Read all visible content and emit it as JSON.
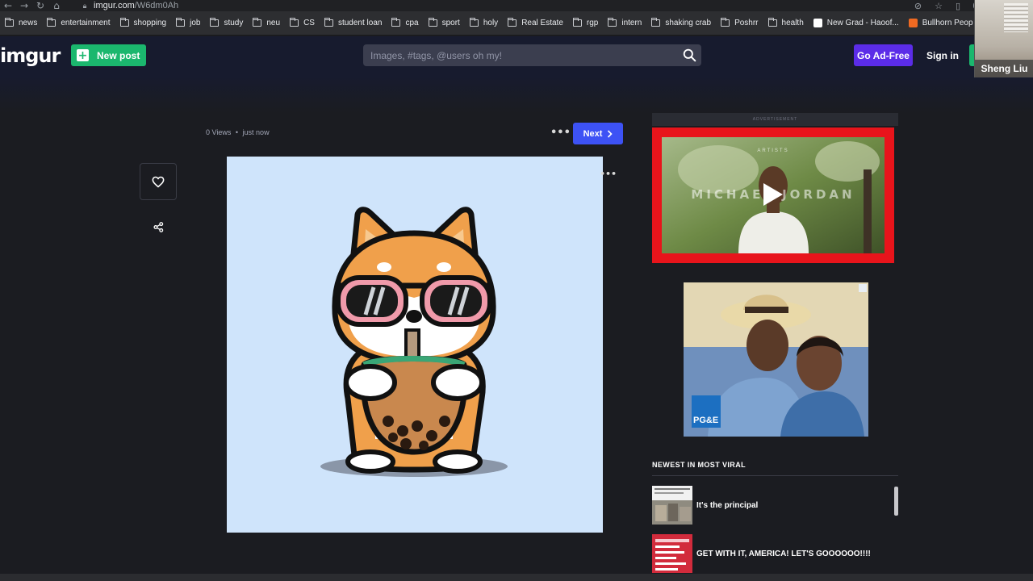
{
  "browser": {
    "url_host": "imgur.com",
    "url_path": "/W6dm0Ah",
    "bookmarks": [
      {
        "label": "news",
        "kind": "folder"
      },
      {
        "label": "entertainment",
        "kind": "folder"
      },
      {
        "label": "shopping",
        "kind": "folder"
      },
      {
        "label": "job",
        "kind": "folder"
      },
      {
        "label": "study",
        "kind": "folder"
      },
      {
        "label": "neu",
        "kind": "folder"
      },
      {
        "label": "CS",
        "kind": "folder"
      },
      {
        "label": "student loan",
        "kind": "folder"
      },
      {
        "label": "cpa",
        "kind": "folder"
      },
      {
        "label": "sport",
        "kind": "folder"
      },
      {
        "label": "holy",
        "kind": "folder"
      },
      {
        "label": "Real Estate",
        "kind": "folder"
      },
      {
        "label": "rgp",
        "kind": "folder"
      },
      {
        "label": "intern",
        "kind": "folder"
      },
      {
        "label": "shaking crab",
        "kind": "folder"
      },
      {
        "label": "Poshrr",
        "kind": "folder"
      },
      {
        "label": "health",
        "kind": "folder"
      },
      {
        "label": "New Grad - Haoof...",
        "kind": "page",
        "color": "#ffffff"
      },
      {
        "label": "Bullhorn Peop",
        "kind": "page",
        "color": "#f06a22"
      }
    ]
  },
  "webcam": {
    "name": "Sheng Liu"
  },
  "header": {
    "logo": "imgur",
    "new_post": "New post",
    "search_placeholder": "Images, #tags, @users oh my!",
    "go_ad_free": "Go Ad-Free",
    "sign_in": "Sign in"
  },
  "post": {
    "views": "0 Views",
    "separator": "•",
    "time": "just now",
    "next": "Next"
  },
  "ads": {
    "strip_label": "ADVERTISEMENT",
    "video_text": "MICHAEL JORDAN",
    "video_label": "ARTISTS",
    "image_ad_logo": "PG&E"
  },
  "viral": {
    "title": "NEWEST IN MOST VIRAL",
    "items": [
      {
        "title": "It's the principal"
      },
      {
        "title": "GET WITH IT, AMERICA! LET'S GOOOOOO!!!!"
      }
    ]
  },
  "colors": {
    "header_bg": "#171b2e",
    "page_bg": "#1b1c21",
    "new_post_green": "#1bb76e",
    "ad_free_purple": "#5b2ce8",
    "next_blue": "#3d52f5",
    "image_bg": "#cfe4fb"
  }
}
